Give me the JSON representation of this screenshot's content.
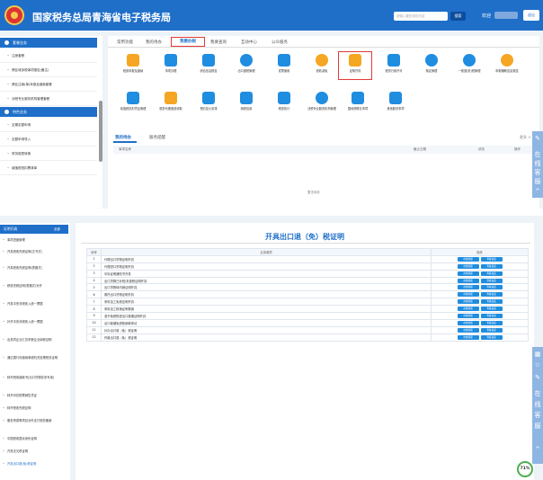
{
  "header": {
    "site_title": "国家税务总局青海省电子税务局",
    "search_placeholder": "请输入要查询的内容",
    "search_label": "搜索",
    "welcome": "欢迎",
    "exit_label": "退出"
  },
  "top_sidebar": {
    "section1": "套餐业务",
    "items1": [
      "注册套餐",
      "跨区域涉税事项报告(备注)",
      "跨区注销(单)年报及缴款套餐",
      "涉税专业服务机构管理套餐"
    ],
    "section2": "特色业务",
    "items2": [
      "定期定额申请",
      "定额申请导入",
      "财务报表转换",
      "增值税抵扣票清单"
    ]
  },
  "top_tabs": [
    "常用功能",
    "我的待办",
    "我要办税",
    "我要查询",
    "互动中心",
    "公众服务"
  ],
  "functions_row1": [
    "税费申报及缴纳",
    "事项办理",
    "综合信息报告",
    "出口退税管理",
    "发票使用",
    "税收减免",
    "证明开具",
    "税务行政许可",
    "核定管理",
    "一般退(抵)税管理",
    "申报辅助信息报告"
  ],
  "functions_row2": [
    "增值税抵扣凭证管理",
    "税务代理缴费收取",
    "预约定价安排",
    "纳税信用",
    "稽查执行",
    "涉税专业服务机构管理",
    "国地税联办事项",
    "其他服务事项"
  ],
  "todo": {
    "tab_active": "我的待办",
    "tab_other": "服务提醒",
    "more": "更多 >",
    "col_name": "事项名称",
    "col_date": "截止日期",
    "col_status": "状态",
    "col_op": "操作",
    "empty": "暂无待办"
  },
  "float_panel": [
    "在",
    "线",
    "客",
    "服"
  ],
  "bottom_sidebar": {
    "title": "证明开具",
    "collapse": "全部",
    "items": [
      "事项进度管理",
      "开具税收完税证明(文书式)",
      "开具税收完税证明(表格式)",
      "税收完税证明(表格式)补开",
      "开具中央非税收入统一票据",
      "补开中央非税收入统一票据",
      "出具同企业汇总申报企业纳税证明",
      "通过银行向缴纳单税机关处理税务证明",
      "转开税收缴款书(出口货物劳务专用)",
      "转开印花税票销售凭证",
      "转开税收完税证明",
      "服务贸易等项目对外支付税务备案",
      "中国税收居民身份证明",
      "开具无欠税证明",
      "开具出口退(免)税证明"
    ]
  },
  "bottom_main": {
    "title": "开具出口退（免）税证明",
    "col_index": "序号",
    "col_item": "业务事项",
    "col_op": "操作",
    "op_apply": "在线填报",
    "op_view": "查看进度",
    "rows": [
      "代理出口货物证明开具",
      "代理进口货物证明开具",
      "中标证明通知书开具",
      "出口货物已补税/未退税证明开具",
      "出口货物转内销证明开具",
      "委托出口货物证明开具",
      "来料加工免税证明开具",
      "来料加工核销证明核销",
      "准予免税购进出口卷烟证明开具",
      "出口卷烟免税核销单申请",
      "补办出口退（免）税证明",
      "作废出口退（免）税证明"
    ]
  },
  "progress": "71%",
  "colors": {
    "primary": "#1f6fc9",
    "highlight": "#e53935",
    "button": "#1f8de0"
  }
}
